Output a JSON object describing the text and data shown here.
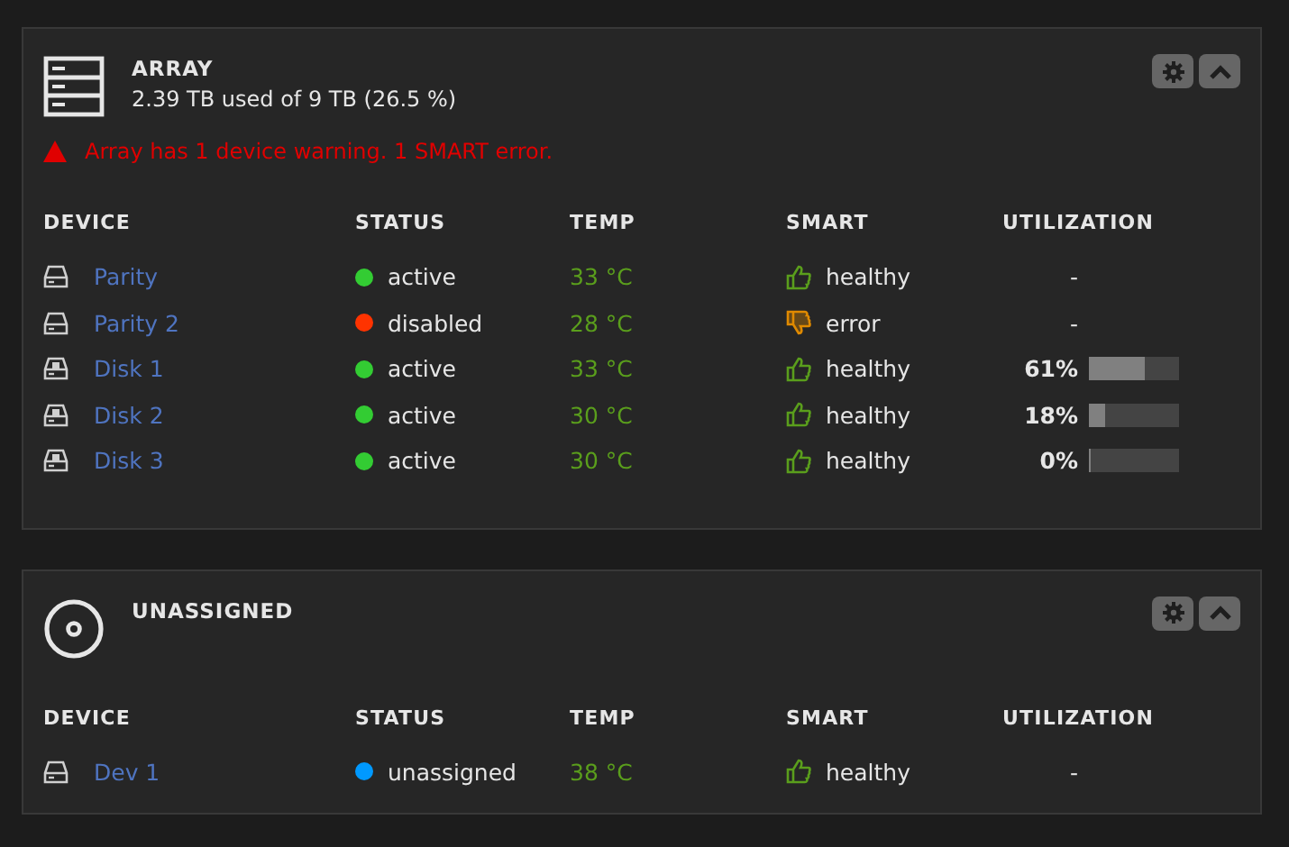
{
  "panels": [
    {
      "kind": "array",
      "title": "ARRAY",
      "subtitle": "2.39 TB used of 9 TB (26.5 %)",
      "warning": "Array has 1 device warning. 1 SMART error.",
      "columns": [
        "DEVICE",
        "STATUS",
        "TEMP",
        "SMART",
        "UTILIZATION"
      ],
      "rows": [
        {
          "kind": "parity",
          "name": "Parity",
          "status": "active",
          "color": "#33cc33",
          "temp": "33 °C",
          "smart_ok": true,
          "smart": "healthy",
          "utilization": "-"
        },
        {
          "kind": "parity",
          "name": "Parity 2",
          "status": "disabled",
          "color": "#ff3300",
          "temp": "28 °C",
          "smart_ok": false,
          "smart": "error",
          "utilization": "-"
        },
        {
          "kind": "disk",
          "name": "Disk 1",
          "status": "active",
          "color": "#33cc33",
          "temp": "33 °C",
          "smart_ok": true,
          "smart": "healthy",
          "utilization": "61%",
          "level": 0.61
        },
        {
          "kind": "disk",
          "name": "Disk 2",
          "status": "active",
          "color": "#33cc33",
          "temp": "30 °C",
          "smart_ok": true,
          "smart": "healthy",
          "utilization": "18%",
          "level": 0.18
        },
        {
          "kind": "disk",
          "name": "Disk 3",
          "status": "active",
          "color": "#33cc33",
          "temp": "30 °C",
          "smart_ok": true,
          "smart": "healthy",
          "utilization": "0%",
          "level": 0
        }
      ]
    },
    {
      "kind": "unassigned",
      "title": "UNASSIGNED",
      "columns": [
        "DEVICE",
        "STATUS",
        "TEMP",
        "SMART",
        "UTILIZATION"
      ],
      "rows": [
        {
          "kind": "parity",
          "name": "Dev 1",
          "status": "unassigned",
          "color": "#0099ff",
          "temp": "38 °C",
          "smart_ok": true,
          "smart": "healthy",
          "utilization": "-"
        }
      ]
    }
  ]
}
